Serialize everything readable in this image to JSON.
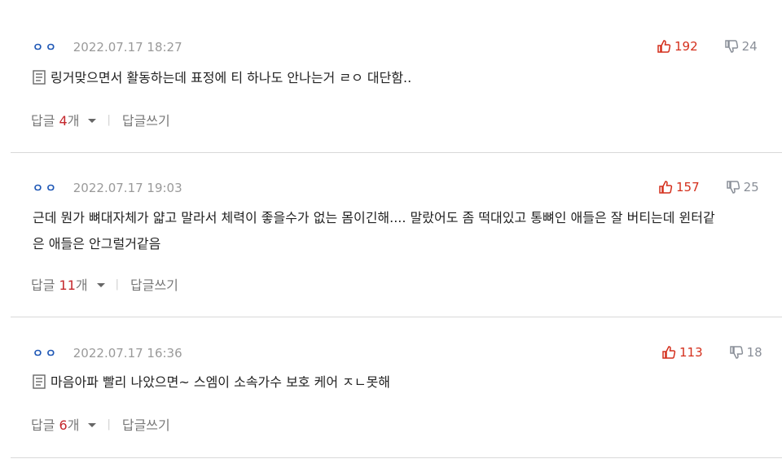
{
  "comments": [
    {
      "author": "ㅇㅇ",
      "date": "2022.07.17 18:27",
      "likes": "192",
      "dislikes": "24",
      "text_lines": [
        "링거맞으면서 활동하는데 표정에 티 하나도 안나는거 ㄹㅇ 대단함.."
      ],
      "has_doc_icon": true,
      "reply_prefix": "답글 ",
      "reply_count": "4",
      "reply_suffix": "개",
      "write_label": "답글쓰기"
    },
    {
      "author": "ㅇㅇ",
      "date": "2022.07.17 19:03",
      "likes": "157",
      "dislikes": "25",
      "text_lines": [
        "근데 뭔가 뼈대자체가 얇고 말라서 체력이 좋을수가 없는 몸이긴해.... 말랐어도 좀 떡대있고 통뼈인 애들은 잘 버티는데 윈터같",
        "은 애들은 안그럴거같음"
      ],
      "has_doc_icon": false,
      "reply_prefix": "답글 ",
      "reply_count": "11",
      "reply_suffix": "개",
      "write_label": "답글쓰기"
    },
    {
      "author": "ㅇㅇ",
      "date": "2022.07.17 16:36",
      "likes": "113",
      "dislikes": "18",
      "text_lines": [
        "마음아파 빨리 나았으면~ 스엠이 소속가수 보호 케어 ㅈㄴ못해"
      ],
      "has_doc_icon": true,
      "reply_prefix": "답글 ",
      "reply_count": "6",
      "reply_suffix": "개",
      "write_label": "답글쓰기"
    }
  ],
  "icons": {
    "like": "thumbs-up-icon",
    "dislike": "thumbs-down-icon",
    "doc": "document-icon",
    "caret": "caret-down-icon"
  },
  "colors": {
    "author": "#1f58b6",
    "like": "#d42f1c",
    "dislike": "#8a8f98",
    "reply_count": "#c4262b"
  },
  "separator": "|"
}
